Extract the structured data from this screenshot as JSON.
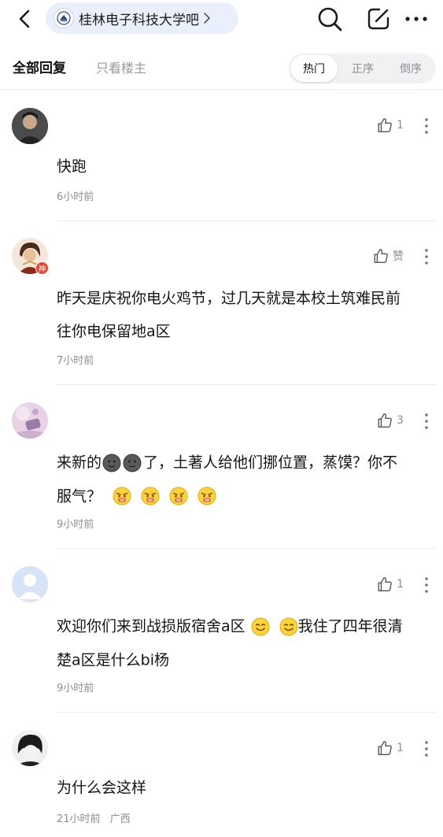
{
  "topbar": {
    "forum_name": "桂林电子科技大学吧",
    "icons": [
      "back-arrow-icon",
      "search-icon",
      "edit-icon",
      "more-icon"
    ]
  },
  "filter": {
    "tab_all": "全部回复",
    "tab_owner": "只看楼主",
    "sort_hot": "热门",
    "sort_asc": "正序",
    "sort_desc": "倒序",
    "active_sort": "热门"
  },
  "comments": [
    {
      "like_label": "1",
      "text": "快跑",
      "time": "6小时前"
    },
    {
      "like_label": "赞",
      "badge": "神",
      "line1": "昨天是庆祝你电火鸡节，过几天就是本校土筑难民前",
      "line2": "往你电保留地a区",
      "time": "7小时前"
    },
    {
      "like_label": "3",
      "line1_a": "来新的",
      "line1_b": "了，土著人给他们挪位置，蒸馍？你不",
      "line2": "服气？",
      "time": "9小时前"
    },
    {
      "like_label": "1",
      "line1_a": "欢迎你们来到战损版宿舍a区",
      "line1_b": "我住了四年很清",
      "line2": "楚a区是什么bi杨",
      "time": "9小时前"
    },
    {
      "like_label": "1",
      "text": "为什么会这样",
      "time": "21小时前",
      "location": "广西"
    }
  ],
  "colors": {
    "pill_bg": "#eaf0fb",
    "muted": "#8e8e93",
    "divider": "#ececec",
    "badge": "#e8402a"
  }
}
